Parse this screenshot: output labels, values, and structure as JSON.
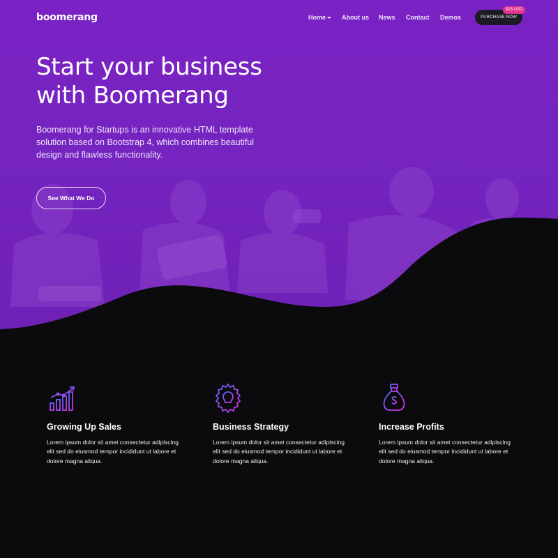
{
  "brand": {
    "name": "boomerang"
  },
  "nav": {
    "items": [
      "Home",
      "About us",
      "News",
      "Contact",
      "Demos"
    ],
    "purchase_label": "PURCHASE NOW",
    "price_badge": "$23 USD"
  },
  "hero": {
    "headline": "Start your business with Boomerang",
    "lead": "Boomerang for Startups is an innovative HTML template solution based on Bootstrap 4, which combines beautiful design and flawless functionality.",
    "cta_label": "See What We Do"
  },
  "features": [
    {
      "icon": "growth-chart-icon",
      "title": "Growing Up Sales",
      "text": "Lorem ipsum dolor sit amet consectetur adipiscing elit sed do eiusmod tempor incididunt ut labore et dolore magna aliqua."
    },
    {
      "icon": "lightbulb-gear-icon",
      "title": "Business Strategy",
      "text": "Lorem ipsum dolor sit amet consectetur adipiscing elit sed do eiusmod tempor incididunt ut labore et dolore magna aliqua."
    },
    {
      "icon": "money-bag-icon",
      "title": "Increase Profits",
      "text": "Lorem ipsum dolor sit amet consectetur adipiscing elit sed do eiusmod tempor incididunt ut labore et dolore magna aliqua."
    }
  ],
  "colors": {
    "hero_purple": "#7a22c4",
    "dark": "#0b0b0d",
    "badge_pink": "#e0338f",
    "icon_gradient_start": "#4f6bff",
    "icon_gradient_end": "#d62ee0"
  }
}
